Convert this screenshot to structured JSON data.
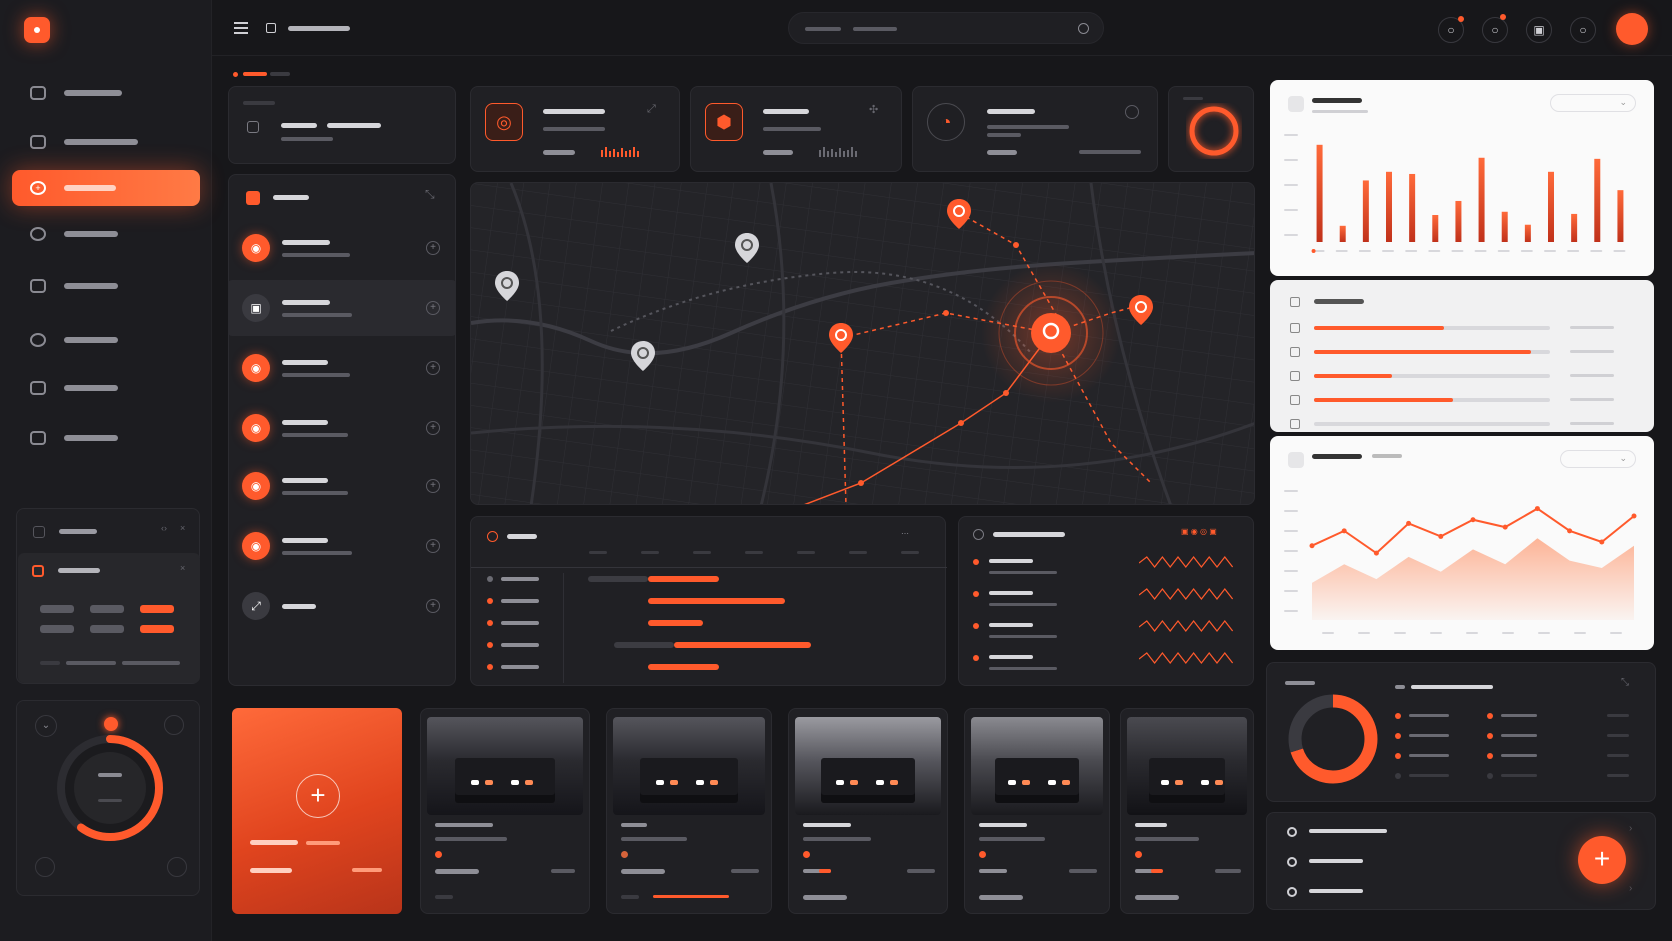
{
  "sidebar": {
    "items": [
      {
        "label": "",
        "icon": "message-icon",
        "active": false
      },
      {
        "label": "",
        "icon": "image-icon",
        "active": false
      },
      {
        "label": "",
        "icon": "compass-icon",
        "active": true
      },
      {
        "label": "",
        "icon": "globe-icon",
        "active": false
      },
      {
        "label": "",
        "icon": "grid-icon",
        "active": false
      },
      {
        "label": "",
        "icon": "upload-icon",
        "active": false
      },
      {
        "label": "",
        "icon": "camera-icon",
        "active": false
      },
      {
        "label": "",
        "icon": "archive-icon",
        "active": false
      }
    ]
  },
  "topbar": {
    "icons": [
      "bell-icon",
      "timer-icon",
      "image-icon",
      "search-icon"
    ]
  },
  "colors": {
    "accent": "#ff5a2c",
    "background": "#17171a",
    "card": "#202024",
    "light_card": "#fafafa"
  },
  "chart_data": [
    {
      "type": "bar",
      "values": [
        90,
        15,
        57,
        65,
        63,
        25,
        38,
        78,
        28,
        16,
        65,
        26,
        77,
        48
      ],
      "title": "",
      "ylim": [
        0,
        100
      ]
    },
    {
      "type": "bar",
      "orientation": "horizontal",
      "values": [
        0.55,
        0.92,
        0.33,
        0.59,
        0.0
      ],
      "note_unit": "fraction"
    },
    {
      "type": "line",
      "series": [
        {
          "values": [
            40,
            48,
            36,
            52,
            45,
            54,
            50,
            60,
            48,
            42,
            56
          ]
        },
        {
          "values": [
            20,
            30,
            22,
            34,
            26,
            38,
            30,
            44,
            32,
            28,
            40
          ]
        }
      ],
      "ylim": [
        0,
        70
      ]
    },
    {
      "type": "pie",
      "values": [
        70,
        30
      ],
      "colors": [
        "#ff5a2c",
        "#3a3a40"
      ]
    }
  ],
  "donut_progress": 0.78,
  "knob_progress": 0.6,
  "list_rows": [
    {
      "icon": "chip-icon",
      "accent": true
    },
    {
      "icon": "vehicle-icon",
      "accent": false
    },
    {
      "icon": "chip-icon",
      "accent": true
    },
    {
      "icon": "chip-icon",
      "accent": true
    },
    {
      "icon": "chip-icon",
      "accent": true
    },
    {
      "icon": "chip-icon",
      "accent": true
    },
    {
      "icon": "expand-icon",
      "accent": false
    }
  ],
  "timeline_bars": [
    {
      "start": 0.18,
      "width": 0.22
    },
    {
      "start": 0.18,
      "width": 0.42
    },
    {
      "start": 0.18,
      "width": 0.17
    },
    {
      "start": 0.26,
      "width": 0.42
    },
    {
      "start": 0.18,
      "width": 0.22
    }
  ]
}
